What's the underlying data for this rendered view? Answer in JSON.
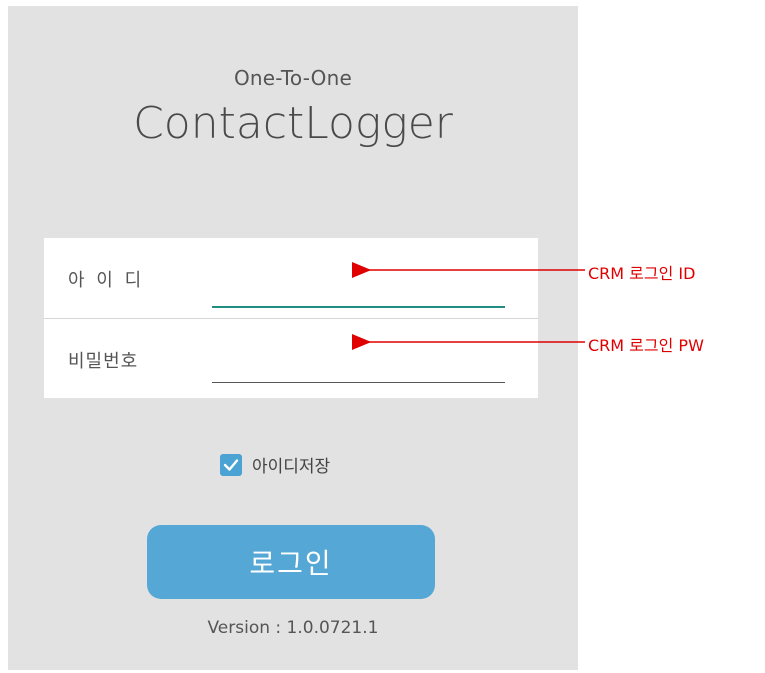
{
  "app": {
    "subtitle": "One-To-One",
    "title": "ContactLogger"
  },
  "form": {
    "id_label": "아 이 디",
    "id_value": "",
    "pw_label": "비밀번호",
    "pw_value": ""
  },
  "remember": {
    "label": "아이디저장",
    "checked": true
  },
  "login_button": {
    "label": "로그인"
  },
  "version": "Version : 1.0.0721.1",
  "annotations": {
    "id_note": "CRM 로그인 ID",
    "pw_note": "CRM 로그인 PW",
    "color": "#e00000"
  },
  "colors": {
    "accent": "#55a8d5",
    "active_underline": "#1f8d7f",
    "panel_bg": "#e2e2e2"
  }
}
